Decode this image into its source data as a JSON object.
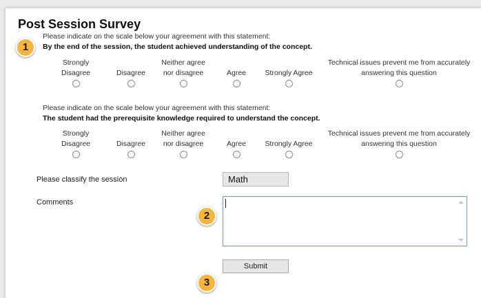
{
  "survey": {
    "title": "Post Session Survey",
    "markers": [
      "1",
      "2",
      "3"
    ],
    "scale_options": [
      [
        "Strongly",
        "Disagree"
      ],
      [
        "",
        "Disagree"
      ],
      [
        "Neither agree",
        "nor disagree"
      ],
      [
        "",
        "Agree"
      ],
      [
        "",
        "Strongly Agree"
      ],
      [
        "Technical issues prevent me from accurately",
        "answering this question"
      ]
    ],
    "questions": [
      {
        "instruction": "Please indicate on the scale below your agreement with this statement:",
        "statement": "By the end of the session, the student achieved understanding of the concept."
      },
      {
        "instruction": "Please indicate on the scale below your agreement with this statement:",
        "statement": "The student had the prerequisite knowledge required to understand the concept."
      }
    ],
    "classify_label": "Please classify the session",
    "classify_value": "Math",
    "comments_label": "Comments",
    "comments_value": "",
    "submit_label": "Submit"
  }
}
